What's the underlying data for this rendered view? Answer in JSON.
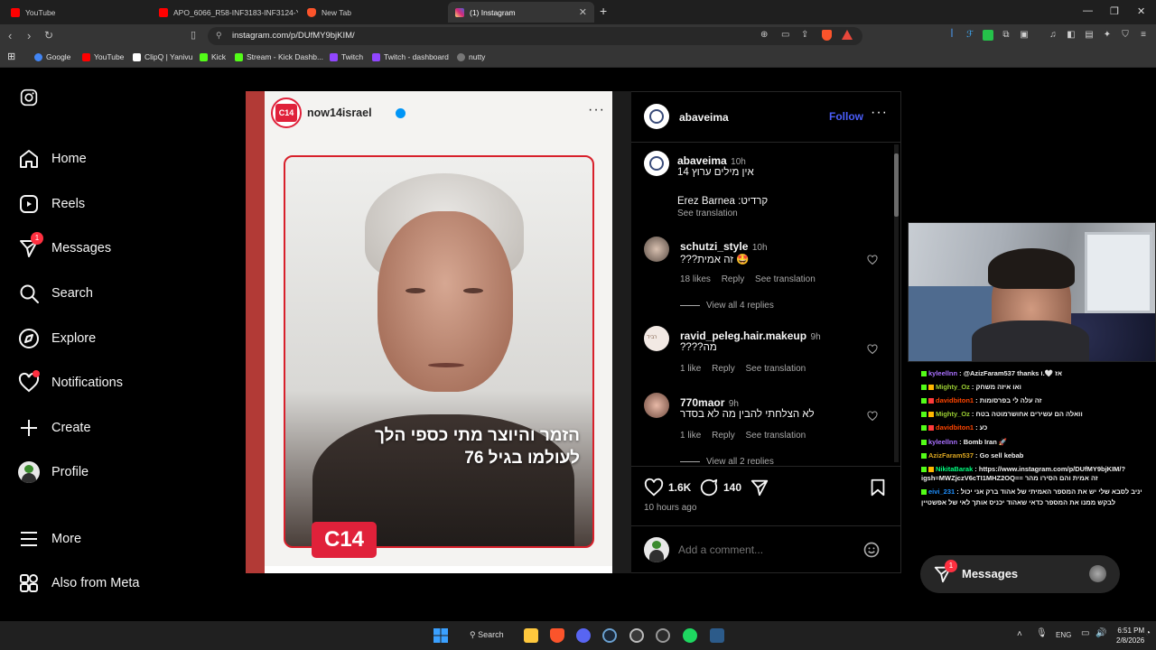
{
  "browser": {
    "tabs": [
      {
        "title": "YouTube",
        "icon_color": "#ff0000"
      },
      {
        "title": "APO_6066_R58-INF3183-INF3124-Y0",
        "icon_color": "#ff0000"
      },
      {
        "title": "New Tab",
        "icon_color": "#fb542b"
      },
      {
        "title": "(1) Instagram",
        "icon_color": "#d6249f"
      }
    ],
    "url": "instagram.com/p/DUfMY9bjKIM/",
    "bookmarks": [
      "Google",
      "YouTube",
      "ClipQ | Yanivu",
      "Kick",
      "Stream - Kick Dashb...",
      "Twitch",
      "Twitch - dashboard",
      "nutty"
    ]
  },
  "sidebar": {
    "items": [
      {
        "label": "Home",
        "icon": "home-icon"
      },
      {
        "label": "Reels",
        "icon": "reels-icon"
      },
      {
        "label": "Messages",
        "icon": "messages-icon",
        "badge": "1"
      },
      {
        "label": "Search",
        "icon": "search-icon"
      },
      {
        "label": "Explore",
        "icon": "explore-icon"
      },
      {
        "label": "Notifications",
        "icon": "heart-icon"
      },
      {
        "label": "Create",
        "icon": "plus-icon"
      },
      {
        "label": "Profile",
        "icon": "profile-avatar"
      },
      {
        "label": "More",
        "icon": "menu-icon"
      },
      {
        "label": "Also from Meta",
        "icon": "meta-icon"
      }
    ]
  },
  "post": {
    "media": {
      "account": "now14israel",
      "logo": "C14",
      "headline_line1": "הזמר והיוצר מתי כספי הלך",
      "headline_line2": "לעולמו בגיל 76",
      "footer_logo": "C14"
    },
    "author": "abaveima",
    "follow_label": "Follow",
    "caption": {
      "user": "abaveima",
      "time": "10h",
      "line1": "אין מילים ערוץ 14",
      "line2": "קרדיט: Erez Barnea",
      "see_translation": "See translation"
    },
    "comments": [
      {
        "user": "schutzi_style",
        "time": "10h",
        "text": "🤩 זה אמית???",
        "likes": "18 likes",
        "reply": "Reply",
        "translate": "See translation",
        "view_replies": "View all 4 replies"
      },
      {
        "user": "ravid_peleg.hair.makeup",
        "time": "9h",
        "text": "מה????",
        "likes": "1 like",
        "reply": "Reply",
        "translate": "See translation"
      },
      {
        "user": "770maor",
        "time": "9h",
        "text": "לא הצלחתי להבין מה לא בסדר",
        "likes": "1 like",
        "reply": "Reply",
        "translate": "See translation",
        "view_replies": "View all 2 replies"
      }
    ],
    "like_count": "1.6K",
    "comment_count": "140",
    "timestamp": "10 hours ago",
    "add_comment_placeholder": "Add a comment..."
  },
  "chat": [
    {
      "user": "kyleellnn",
      "msg": ": @AzizFaram537 thanks אז 🤍.ו",
      "color": "#a970ff"
    },
    {
      "user": "Mighty_Oz",
      "msg": ": ואו איזה משחק",
      "color": "#9acd32"
    },
    {
      "user": "davidbiton1",
      "msg": ": זה עלה לי בפרסומות",
      "color": "#ff4500"
    },
    {
      "user": "Mighty_Oz",
      "msg": ": וואלה הם עשירים אחושרמוטה בטח",
      "color": "#9acd32"
    },
    {
      "user": "davidbiton1",
      "msg": ": כע",
      "color": "#ff4500"
    },
    {
      "user": "kyleellnn",
      "msg": ": Bomb Iran 🚀",
      "color": "#a970ff"
    },
    {
      "user": "AzizFaram537",
      "msg": ": Go sell kebab",
      "color": "#daa520"
    },
    {
      "user": "NikitaBarak",
      "msg": ": https://www.instagram.com/p/DUfMY9bjKIM/?",
      "color": "#00ff7f"
    },
    {
      "user": "",
      "msg": "igsh=MWZjczV6cTI1MHZ2OQ== זה אמית והם הסירו מהר",
      "color": "#f1f1f1"
    },
    {
      "user": "eivi_231",
      "msg": ": יניב לסבא שלי יש את המספר האמיתי של אהוד ברק אני יכול",
      "color": "#1e90ff"
    },
    {
      "user": "",
      "msg": "לבקש ממנו את המספר כדאי שאהוד יכניס אותך לאי של אפשטיין",
      "color": "#f1f1f1"
    }
  ],
  "messages_pill": {
    "label": "Messages",
    "badge": "1"
  },
  "taskbar": {
    "search_label": "Search",
    "lang": "ENG",
    "time": "6:51 PM",
    "date": "2/8/2026"
  }
}
